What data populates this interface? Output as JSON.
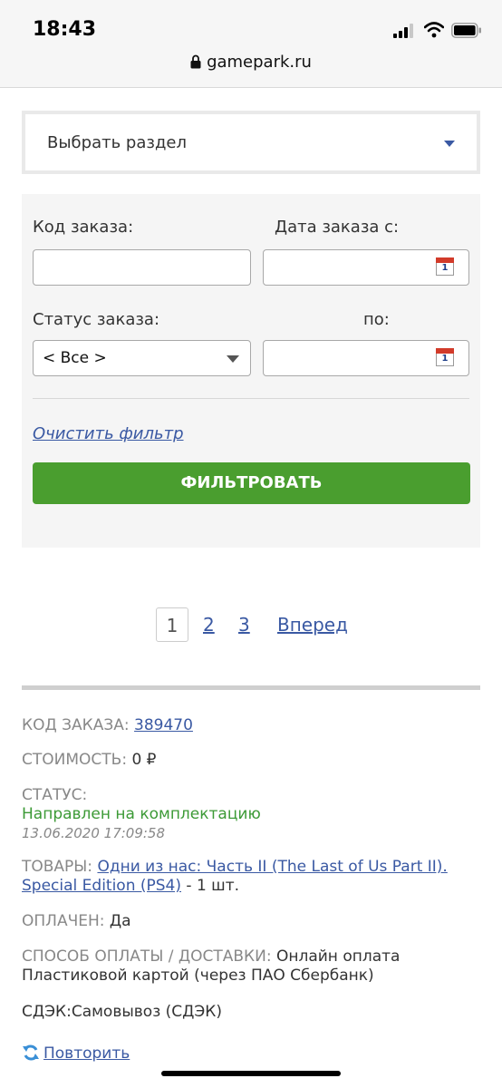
{
  "status_bar": {
    "time": "18:43"
  },
  "browser": {
    "url": "gamepark.ru"
  },
  "section_select": {
    "label": "Выбрать раздел"
  },
  "filter": {
    "order_code_label": "Код заказа:",
    "order_code_value": "",
    "date_from_label": "Дата заказа с:",
    "date_from_value": "",
    "status_label": "Статус заказа:",
    "status_value": "< Все >",
    "date_to_label": "по:",
    "date_to_value": "",
    "calendar_day": "1",
    "clear_label": "Очистить фильтр",
    "submit_label": "ФИЛЬТРОВАТЬ"
  },
  "pagination": {
    "pages": [
      "1",
      "2",
      "3"
    ],
    "current": "1",
    "next_label": "Вперед"
  },
  "order": {
    "code_key": "КОД ЗАКАЗА:",
    "code_value": "389470",
    "cost_key": "СТОИМОСТЬ:",
    "cost_value": "0 ₽",
    "status_key": "СТАТУС:",
    "status_value": "Направлен на комплектацию",
    "status_date": "13.06.2020 17:09:58",
    "goods_key": "ТОВАРЫ:",
    "goods_link": "Одни из нас: Часть II (The Last of Us Part II). Special Edition (PS4)",
    "goods_qty": " - 1 шт.",
    "paid_key": "ОПЛАЧЕН:",
    "paid_value": "Да",
    "payment_key": "СПОСОБ ОПЛАТЫ / ДОСТАВКИ:",
    "payment_value": "Онлайн оплата Пластиковой картой (через ПАО Сбербанк)",
    "delivery_value": "СДЭК:Самовывоз (СДЭК)",
    "repeat_label": "Повторить"
  },
  "colors": {
    "link": "#3a59a3",
    "button_green": "#4a9e2f",
    "status_green": "#3c9a36"
  }
}
